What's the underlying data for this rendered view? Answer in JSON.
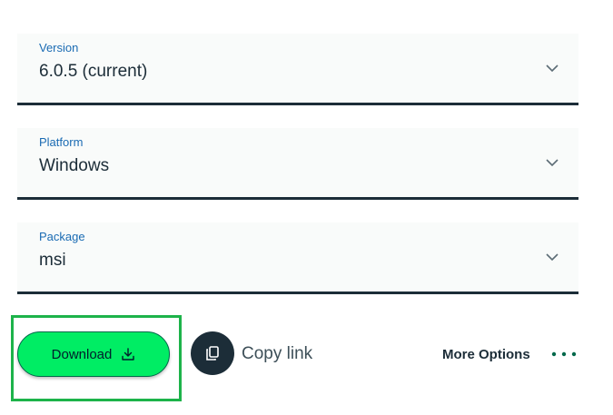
{
  "version": {
    "label": "Version",
    "value": "6.0.5 (current)"
  },
  "platform": {
    "label": "Platform",
    "value": "Windows"
  },
  "package": {
    "label": "Package",
    "value": "msi"
  },
  "actions": {
    "download_label": "Download",
    "download_icon": "download-icon",
    "copy_label": "Copy link",
    "copy_icon": "copy-icon",
    "more_label": "More Options",
    "more_icon": "ellipsis-icon"
  },
  "colors": {
    "accent_green": "#00ed64",
    "highlight_green": "#1db34a",
    "label_blue": "#1a6bb3",
    "dark": "#1c2d38",
    "dots_green": "#00684a"
  }
}
